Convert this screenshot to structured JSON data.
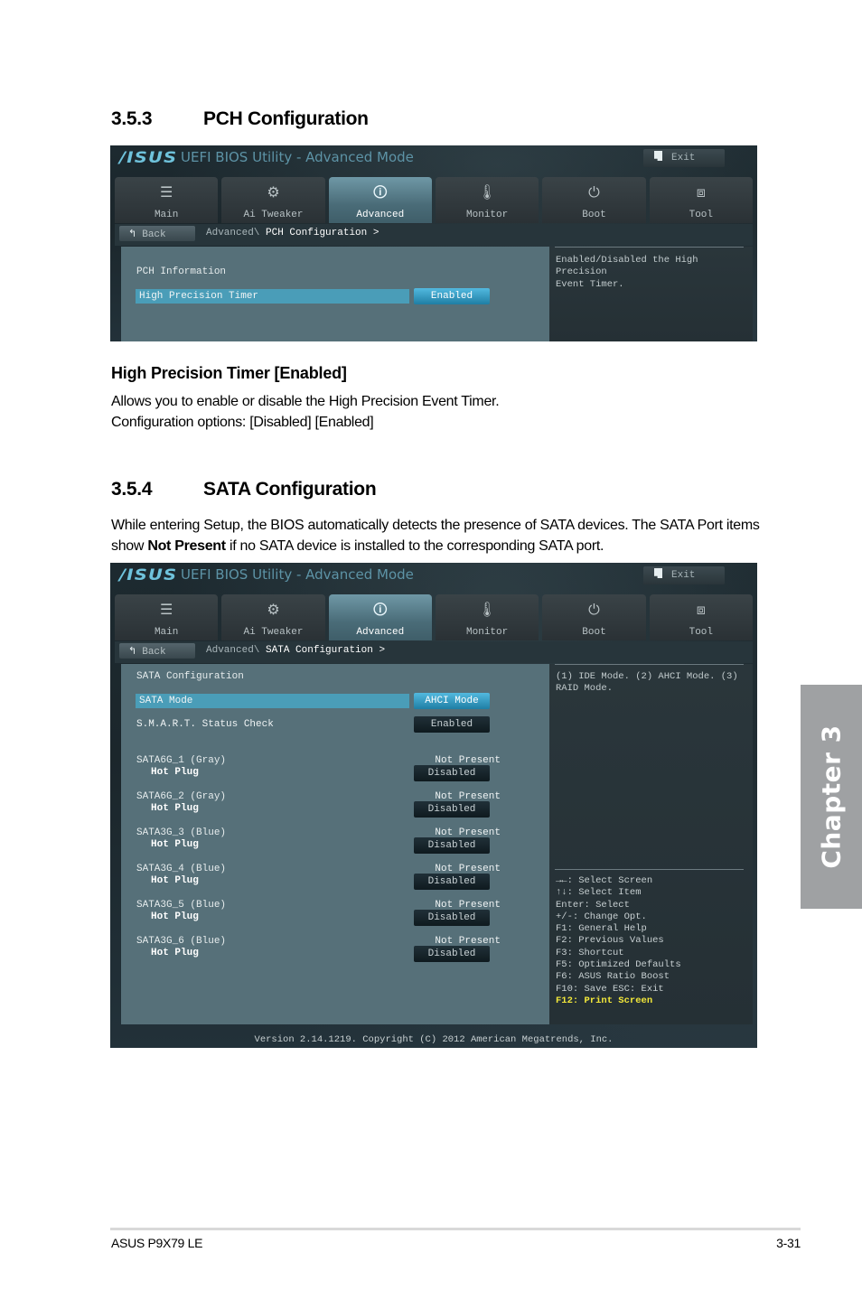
{
  "section_353": {
    "number": "3.5.3",
    "title": "PCH Configuration"
  },
  "bios_common": {
    "logo": "/ISUS",
    "app_title": "UEFI BIOS Utility - Advanced Mode",
    "exit_label": "Exit",
    "back_label": "Back",
    "tabs": [
      {
        "label": "Main",
        "icon": "list-icon",
        "glyph": "☰"
      },
      {
        "label": "Ai Tweaker",
        "icon": "ai-tweaker-icon",
        "glyph": "⚙"
      },
      {
        "label": "Advanced",
        "icon": "advanced-icon",
        "glyph": "🛈"
      },
      {
        "label": "Monitor",
        "icon": "monitor-thermometer-icon",
        "glyph": "🌡"
      },
      {
        "label": "Boot",
        "icon": "power-icon",
        "glyph": "⏻"
      },
      {
        "label": "Tool",
        "icon": "toolbox-icon",
        "glyph": "⧈"
      }
    ],
    "active_tab": "Advanced",
    "colors": {
      "accent": "#4a9db8",
      "selected_button": "#52b9df",
      "panel": "#567079",
      "highlight_key": "#f3e83a"
    }
  },
  "bios_pch": {
    "breadcrumb_parent": "Advanced\\",
    "breadcrumb_current": "PCH Configuration >",
    "header_item": "PCH Information",
    "items": [
      {
        "label": "High Precision Timer",
        "value": "Enabled",
        "highlighted": true
      }
    ],
    "help": "Enabled/Disabled the High Precision\nEvent Timer."
  },
  "hpet_section": {
    "title": "High Precision Timer [Enabled]",
    "desc_line1": "Allows you to enable or disable the High Precision Event Timer.",
    "desc_line2": "Configuration options: [Disabled] [Enabled]"
  },
  "section_354": {
    "number": "3.5.4",
    "title": "SATA Configuration",
    "para_part1": "While entering Setup, the BIOS automatically detects the presence of SATA devices. The SATA Port items show ",
    "para_bold": "Not Present",
    "para_part2": " if no SATA device is installed to the corresponding SATA port."
  },
  "bios_sata": {
    "breadcrumb_parent": "Advanced\\",
    "breadcrumb_current": "SATA Configuration >",
    "header_item": "SATA Configuration",
    "sata_mode": {
      "label": "SATA Mode",
      "value": "AHCI Mode"
    },
    "smart": {
      "label": "S.M.A.R.T. Status Check",
      "value": "Enabled"
    },
    "ports": [
      {
        "name": "SATA6G_1 (Gray)",
        "status": "Not Present",
        "sub_label": "Hot Plug",
        "sub_value": "Disabled"
      },
      {
        "name": "SATA6G_2 (Gray)",
        "status": "Not Present",
        "sub_label": "Hot Plug",
        "sub_value": "Disabled"
      },
      {
        "name": "SATA3G_3 (Blue)",
        "status": "Not Present",
        "sub_label": "Hot Plug",
        "sub_value": "Disabled"
      },
      {
        "name": "SATA3G_4 (Blue)",
        "status": "Not Present",
        "sub_label": "Hot Plug",
        "sub_value": "Disabled"
      },
      {
        "name": "SATA3G_5 (Blue)",
        "status": "Not Present",
        "sub_label": "Hot Plug",
        "sub_value": "Disabled"
      },
      {
        "name": "SATA3G_6 (Blue)",
        "status": "Not Present",
        "sub_label": "Hot Plug",
        "sub_value": "Disabled"
      }
    ],
    "help": "(1) IDE Mode. (2) AHCI Mode. (3)\nRAID Mode.",
    "keys": [
      "→←: Select Screen",
      "↑↓: Select Item",
      "Enter: Select",
      "+/-: Change Opt.",
      "F1: General Help",
      "F2: Previous Values",
      "F3: Shortcut",
      "F5: Optimized Defaults",
      "F6: ASUS Ratio Boost",
      "F10: Save  ESC: Exit"
    ],
    "key_highlight": "F12: Print Screen",
    "version": "Version 2.14.1219. Copyright (C) 2012 American Megatrends, Inc."
  },
  "chapter_tab": "Chapter 3",
  "footer": {
    "product": "ASUS P9X79 LE",
    "page": "3-31"
  }
}
